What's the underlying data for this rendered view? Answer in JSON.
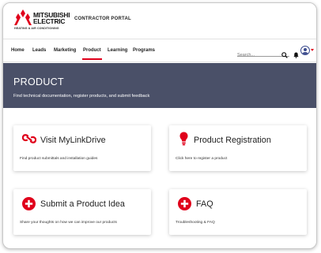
{
  "brand": {
    "logo_line1": "MITSUBISHI",
    "logo_line2": "ELECTRIC",
    "logo_tagline": "HEATING & AIR CONDITIONING",
    "portal_title": "CONTRACTOR PORTAL"
  },
  "nav": {
    "items": [
      {
        "label": "Home",
        "active": false
      },
      {
        "label": "Leads",
        "active": false
      },
      {
        "label": "Marketing",
        "active": false
      },
      {
        "label": "Product",
        "active": true
      },
      {
        "label": "Learning",
        "active": false
      },
      {
        "label": "Programs",
        "active": false
      }
    ],
    "search_placeholder": "Search..."
  },
  "hero": {
    "title": "PRODUCT",
    "subtitle": "Find technical documentation, register products, and submit feedback"
  },
  "cards": [
    {
      "title": "Visit MyLinkDrive",
      "description": "Find product submittals and installation guides",
      "icon": "link-icon"
    },
    {
      "title": "Product Registration",
      "description": "Click here to register a product",
      "icon": "lightbulb-icon"
    },
    {
      "title": "Submit a Product Idea",
      "description": "Share your thoughts on how we can improve our products",
      "icon": "plus-circle-icon"
    },
    {
      "title": "FAQ",
      "description": "Troubleshooting & FAQ",
      "icon": "plus-circle-icon"
    }
  ],
  "colors": {
    "accent": "#e0001b",
    "hero_bg": "#4a5068",
    "avatar": "#3a4a8c"
  }
}
